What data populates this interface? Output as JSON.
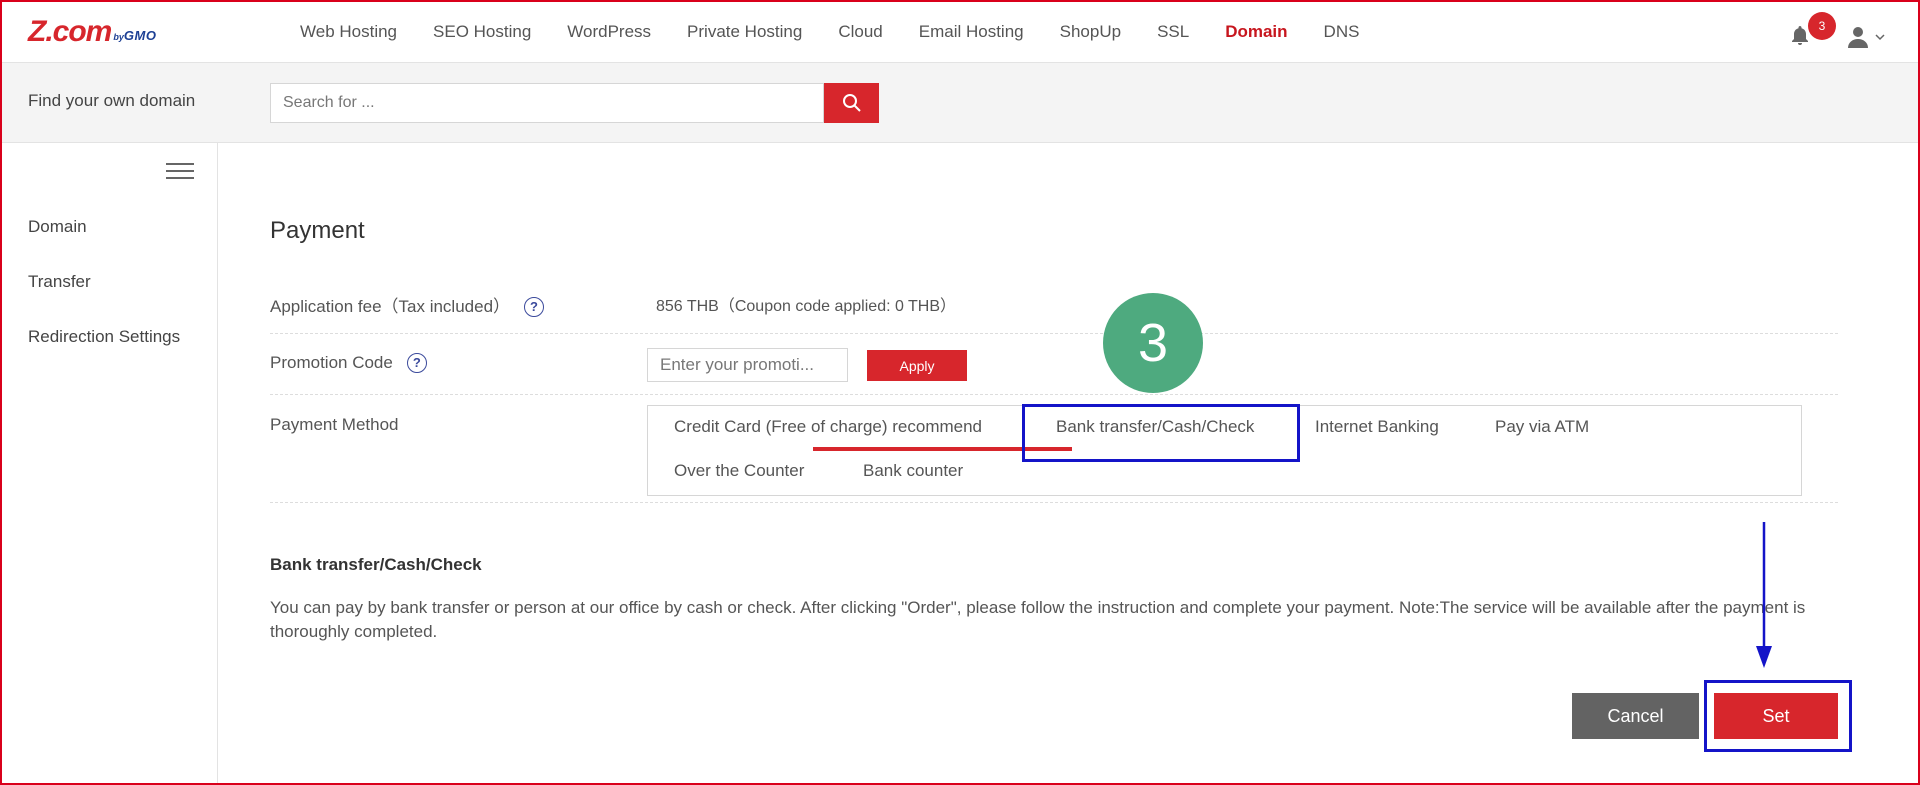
{
  "header": {
    "logo": {
      "main": "Z.com",
      "by": "by",
      "brand": "GMO"
    },
    "nav": [
      {
        "label": "Web Hosting",
        "active": false
      },
      {
        "label": "SEO Hosting",
        "active": false
      },
      {
        "label": "WordPress",
        "active": false
      },
      {
        "label": "Private Hosting",
        "active": false
      },
      {
        "label": "Cloud",
        "active": false
      },
      {
        "label": "Email Hosting",
        "active": false
      },
      {
        "label": "ShopUp",
        "active": false
      },
      {
        "label": "SSL",
        "active": false
      },
      {
        "label": "Domain",
        "active": true
      },
      {
        "label": "DNS",
        "active": false
      }
    ],
    "notification_count": "3",
    "icons": {
      "bell": "bell-icon",
      "user": "user-icon",
      "chevron": "chevron-down-icon"
    }
  },
  "search": {
    "label": "Find your own domain",
    "placeholder": "Search for ...",
    "icon": "search-icon"
  },
  "sidebar": {
    "items": [
      {
        "label": "Domain"
      },
      {
        "label": "Transfer"
      },
      {
        "label": "Redirection Settings"
      }
    ]
  },
  "payment": {
    "title": "Payment",
    "fee_label": "Application fee（Tax included）",
    "fee_value": "856 THB（Coupon code applied:   0 THB）",
    "promo_label": "Promotion Code",
    "promo_placeholder": "Enter your promoti...",
    "apply_label": "Apply",
    "method_label": "Payment Method",
    "methods": [
      {
        "label": "Credit Card (Free of charge) recommend",
        "selected": false
      },
      {
        "label": "Bank transfer/Cash/Check",
        "selected": true
      },
      {
        "label": "Internet Banking",
        "selected": false
      },
      {
        "label": "Pay via ATM",
        "selected": false
      },
      {
        "label": "Over the Counter",
        "selected": false
      },
      {
        "label": "Bank counter",
        "selected": false
      }
    ],
    "selected_title": "Bank transfer/Cash/Check",
    "selected_desc": "You can pay by bank transfer or person at our office by cash or check. After clicking \"Order\", please follow the instruction and complete your payment. Note:The service will be available after the payment is thoroughly completed.",
    "cancel_label": "Cancel",
    "set_label": "Set"
  },
  "annotation": {
    "step": "3",
    "colors": {
      "highlight": "#1414c8",
      "step_circle": "#4eaa7f",
      "accent": "#d7262c"
    }
  }
}
